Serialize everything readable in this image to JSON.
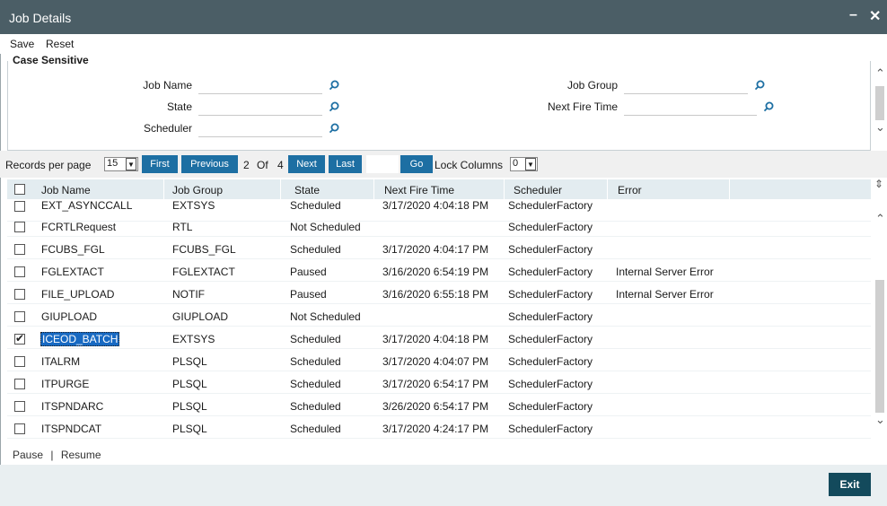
{
  "window": {
    "title": "Job Details",
    "minimize_icon": "minimize-icon",
    "close_icon": "close-icon"
  },
  "menu": {
    "save": "Save",
    "reset": "Reset"
  },
  "criteria": {
    "section_title": "Case Sensitive",
    "job_name_label": "Job Name",
    "state_label": "State",
    "scheduler_label": "Scheduler",
    "job_group_label": "Job Group",
    "next_fire_time_label": "Next Fire Time",
    "job_name_value": "",
    "state_value": "",
    "scheduler_value": "",
    "job_group_value": "",
    "next_fire_time_value": ""
  },
  "pager": {
    "records_label": "Records per page",
    "records_value": "15",
    "first": "First",
    "previous": "Previous",
    "current_page": "2",
    "of": "Of",
    "total_pages": "4",
    "next": "Next",
    "last": "Last",
    "go": "Go",
    "lock_label": "Lock Columns",
    "lock_value": "0"
  },
  "grid": {
    "columns": [
      "Job Name",
      "Job Group",
      "State",
      "Next Fire Time",
      "Scheduler",
      "Error"
    ],
    "rows": [
      {
        "name": "EXT_ASYNCCALL",
        "group": "EXTSYS",
        "state": "Scheduled",
        "next": "3/17/2020 4:04:18 PM",
        "scheduler": "SchedulerFactory",
        "error": "",
        "checked": false
      },
      {
        "name": "FCRTLRequest",
        "group": "RTL",
        "state": "Not Scheduled",
        "next": "",
        "scheduler": "SchedulerFactory",
        "error": "",
        "checked": false
      },
      {
        "name": "FCUBS_FGL",
        "group": "FCUBS_FGL",
        "state": "Scheduled",
        "next": "3/17/2020 4:04:17 PM",
        "scheduler": "SchedulerFactory",
        "error": "",
        "checked": false
      },
      {
        "name": "FGLEXTACT",
        "group": "FGLEXTACT",
        "state": "Paused",
        "next": "3/16/2020 6:54:19 PM",
        "scheduler": "SchedulerFactory",
        "error": "Internal Server Error",
        "checked": false
      },
      {
        "name": "FILE_UPLOAD",
        "group": "NOTIF",
        "state": "Paused",
        "next": "3/16/2020 6:55:18 PM",
        "scheduler": "SchedulerFactory",
        "error": "Internal Server Error",
        "checked": false
      },
      {
        "name": "GIUPLOAD",
        "group": "GIUPLOAD",
        "state": "Not Scheduled",
        "next": "",
        "scheduler": "SchedulerFactory",
        "error": "",
        "checked": false
      },
      {
        "name": "ICEOD_BATCH",
        "group": "EXTSYS",
        "state": "Scheduled",
        "next": "3/17/2020 4:04:18 PM",
        "scheduler": "SchedulerFactory",
        "error": "",
        "checked": true
      },
      {
        "name": "ITALRM",
        "group": "PLSQL",
        "state": "Scheduled",
        "next": "3/17/2020 4:04:07 PM",
        "scheduler": "SchedulerFactory",
        "error": "",
        "checked": false
      },
      {
        "name": "ITPURGE",
        "group": "PLSQL",
        "state": "Scheduled",
        "next": "3/17/2020 6:54:17 PM",
        "scheduler": "SchedulerFactory",
        "error": "",
        "checked": false
      },
      {
        "name": "ITSPNDARC",
        "group": "PLSQL",
        "state": "Scheduled",
        "next": "3/26/2020 6:54:17 PM",
        "scheduler": "SchedulerFactory",
        "error": "",
        "checked": false
      },
      {
        "name": "ITSPNDCAT",
        "group": "PLSQL",
        "state": "Scheduled",
        "next": "3/17/2020 4:24:17 PM",
        "scheduler": "SchedulerFactory",
        "error": "",
        "checked": false
      }
    ],
    "selected_row": 6
  },
  "actions": {
    "pause": "Pause",
    "separator": "|",
    "resume": "Resume"
  },
  "footer": {
    "exit": "Exit"
  },
  "colors": {
    "title_bar": "#4b5e66",
    "button": "#1d6fa3",
    "exit_button": "#134a5c",
    "grid_header": "#e3ecf0",
    "selection": "#1769c2"
  }
}
